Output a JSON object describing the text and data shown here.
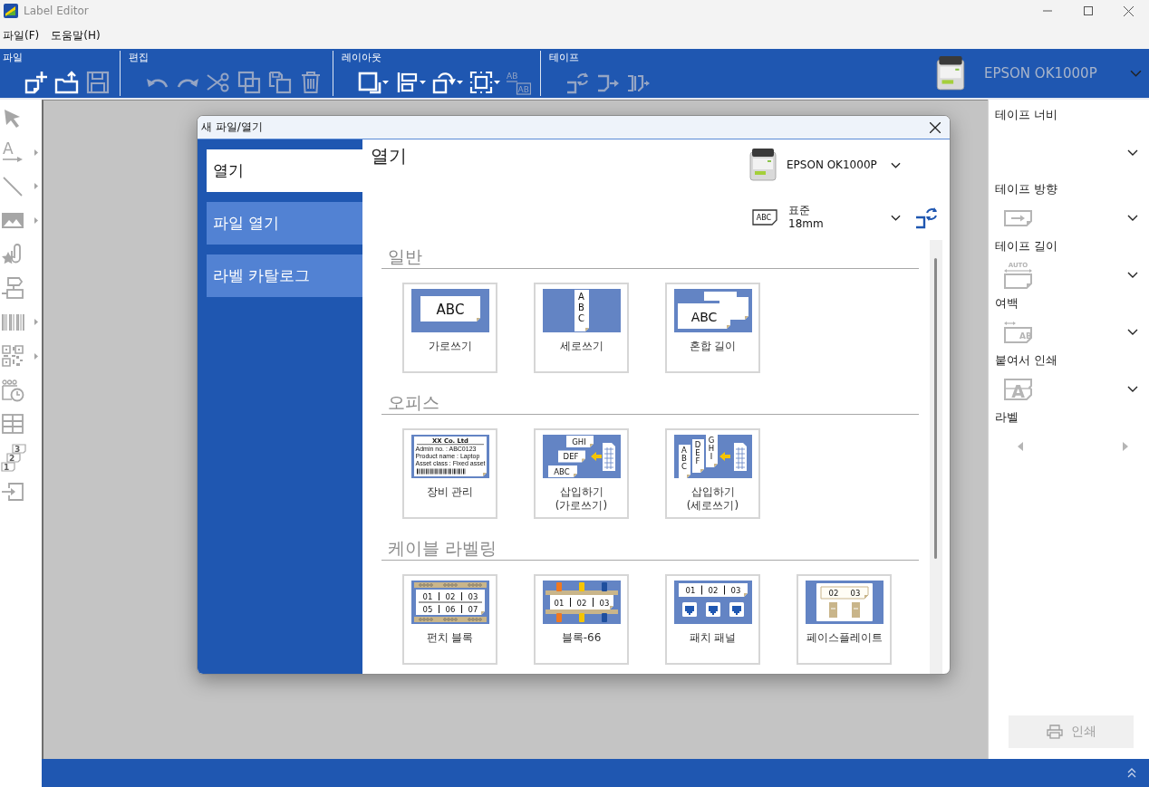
{
  "window": {
    "title": "Label Editor"
  },
  "menu": [
    {
      "label": "파일(F)"
    },
    {
      "label": "도움말(H)"
    }
  ],
  "ribbon": {
    "groups": [
      {
        "label": "파일",
        "tools": [
          {
            "kind": "new",
            "disabled": false
          },
          {
            "kind": "open",
            "disabled": false
          },
          {
            "kind": "save",
            "disabled": true
          }
        ]
      },
      {
        "label": "편집",
        "tools": [
          {
            "kind": "undo",
            "disabled": true
          },
          {
            "kind": "redo",
            "disabled": true
          },
          {
            "kind": "cut",
            "disabled": true
          },
          {
            "kind": "copy",
            "disabled": true
          },
          {
            "kind": "paste",
            "disabled": true
          },
          {
            "kind": "delete",
            "disabled": true
          }
        ]
      },
      {
        "label": "레이아웃",
        "tools": [
          {
            "kind": "frame",
            "disabled": false,
            "dropdown": true
          },
          {
            "kind": "align",
            "disabled": false,
            "dropdown": true
          },
          {
            "kind": "rotate",
            "disabled": false,
            "dropdown": true
          },
          {
            "kind": "center",
            "disabled": false,
            "dropdown": true
          },
          {
            "kind": "fit",
            "disabled": true,
            "dropdown": false,
            "glyphs": [
              "AB",
              "AB"
            ]
          }
        ]
      },
      {
        "label": "테이프",
        "tools": [
          {
            "kind": "tape-detect",
            "disabled": true
          },
          {
            "kind": "feed",
            "disabled": true
          },
          {
            "kind": "cut-tape",
            "disabled": true
          }
        ]
      }
    ],
    "printer": {
      "name": "EPSON OK1000P"
    }
  },
  "tool_palette": [
    {
      "kind": "select",
      "submenu": false
    },
    {
      "kind": "text",
      "submenu": true,
      "glyphs": [
        "A"
      ]
    },
    {
      "kind": "line",
      "submenu": true
    },
    {
      "kind": "image",
      "submenu": true
    },
    {
      "kind": "clipart",
      "submenu": false
    },
    {
      "kind": "shape",
      "submenu": false
    },
    {
      "kind": "barcode",
      "submenu": true
    },
    {
      "kind": "qrcode",
      "submenu": true
    },
    {
      "kind": "datetime",
      "submenu": false
    },
    {
      "kind": "table",
      "submenu": false
    },
    {
      "kind": "numbering",
      "submenu": false,
      "glyphs": [
        "3",
        "2",
        "1"
      ]
    },
    {
      "kind": "import",
      "submenu": false
    }
  ],
  "dialog": {
    "title": "새 파일/열기",
    "nav": [
      {
        "label": "열기",
        "selected": true
      },
      {
        "label": "파일 열기",
        "selected": false
      },
      {
        "label": "라벨 카탈로그",
        "selected": false
      }
    ],
    "heading": "열기",
    "printer": {
      "name": "EPSON OK1000P"
    },
    "tape": {
      "glyphs": [
        "ABC"
      ],
      "type": "표준",
      "width": "18mm"
    },
    "sections": [
      {
        "title": "일반",
        "templates": [
          {
            "kind": "horizontal",
            "label": "가로쓰기",
            "glyphs": [
              "ABC"
            ]
          },
          {
            "kind": "vertical",
            "label": "세로쓰기",
            "glyphs": [
              "ABC"
            ]
          },
          {
            "kind": "mixed",
            "label": "혼합 길이",
            "glyphs": [
              "ABC"
            ]
          }
        ]
      },
      {
        "title": "오피스",
        "templates": [
          {
            "kind": "asset",
            "label": "장비 관리",
            "glyphs": [
              "XX Co. Ltd",
              "Admin no. : ABC0123",
              "Product name : Laptop",
              "Asset class : Fixed asset"
            ]
          },
          {
            "kind": "insert-horizontal",
            "label": "삽입하기\n(가로쓰기)",
            "glyphs": [
              "GHI",
              "DEF",
              "ABC"
            ]
          },
          {
            "kind": "insert-vertical",
            "label": "삽입하기\n(세로쓰기)",
            "glyphs": [
              "ABC",
              "DEF",
              "GHI"
            ]
          }
        ]
      },
      {
        "title": "케이블 라벨링",
        "templates": [
          {
            "kind": "punch",
            "label": "펀치 블록",
            "glyphs": [
              "01",
              "02",
              "03",
              "05",
              "06",
              "07"
            ]
          },
          {
            "kind": "block66",
            "label": "블록-66",
            "glyphs": [
              "01",
              "02",
              "03"
            ]
          },
          {
            "kind": "patch",
            "label": "패치 패널",
            "glyphs": [
              "01",
              "02",
              "03"
            ]
          },
          {
            "kind": "faceplate",
            "label": "페이스플레이트",
            "glyphs": [
              "02",
              "03"
            ]
          }
        ]
      }
    ]
  },
  "properties": [
    {
      "kind": "tape-width",
      "label": "테이프 너비"
    },
    {
      "kind": "tape-direction",
      "label": "테이프 방향"
    },
    {
      "kind": "tape-length",
      "label": "테이프 길이",
      "glyphs": [
        "AUTO"
      ]
    },
    {
      "kind": "margin",
      "label": "여백",
      "glyphs": [
        "AB"
      ]
    },
    {
      "kind": "concat-print",
      "label": "붙여서 인쇄",
      "glyphs": [
        "A"
      ]
    },
    {
      "kind": "label-nav",
      "label": "라벨"
    }
  ],
  "print_button": {
    "label": "인쇄",
    "disabled": true
  }
}
